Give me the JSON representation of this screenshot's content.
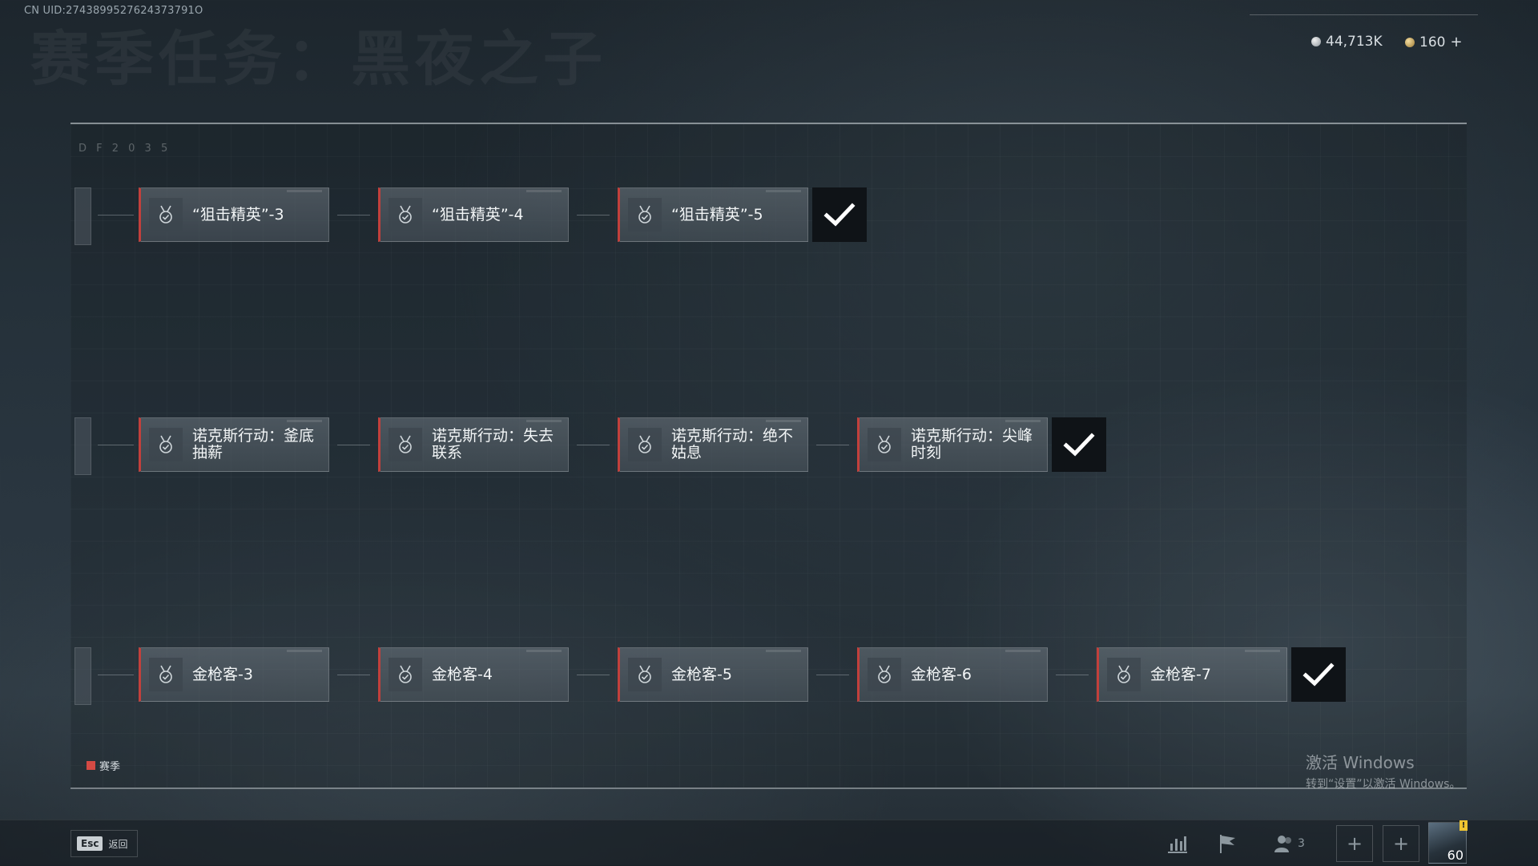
{
  "header": {
    "uid": "CN UID:2743899527624373791O",
    "title": "赛季任务：黑夜之子",
    "currency_silver": "44,713K",
    "currency_gold": "160",
    "currency_plus": "+"
  },
  "panel": {
    "df_label": "D F 2 0 3 5"
  },
  "rows": [
    {
      "tasks": [
        "“狙击精英”-3",
        "“狙击精英”-4",
        "“狙击精英”-5"
      ],
      "completed": true
    },
    {
      "tasks": [
        "诺克斯行动：釜底抽薪",
        "诺克斯行动：失去联系",
        "诺克斯行动：绝不姑息",
        "诺克斯行动：尖峰时刻"
      ],
      "completed": true
    },
    {
      "tasks": [
        "金枪客-3",
        "金枪客-4",
        "金枪客-5",
        "金枪客-6",
        "金枪客-7"
      ],
      "completed": true
    }
  ],
  "legend": {
    "label": "赛季",
    "color": "#d44a44"
  },
  "watermark": {
    "line1": "激活 Windows",
    "line2": "转到“设置”以激活 Windows。"
  },
  "bottombar": {
    "esc_key": "Esc",
    "esc_label": "返回",
    "friends_count": "3",
    "plus_symbol": "+",
    "player_level": "60",
    "alert_symbol": "!",
    "icons": [
      "stats-icon",
      "flag-icon",
      "friends-icon",
      "plus-icon",
      "plus-icon",
      "avatar"
    ]
  }
}
